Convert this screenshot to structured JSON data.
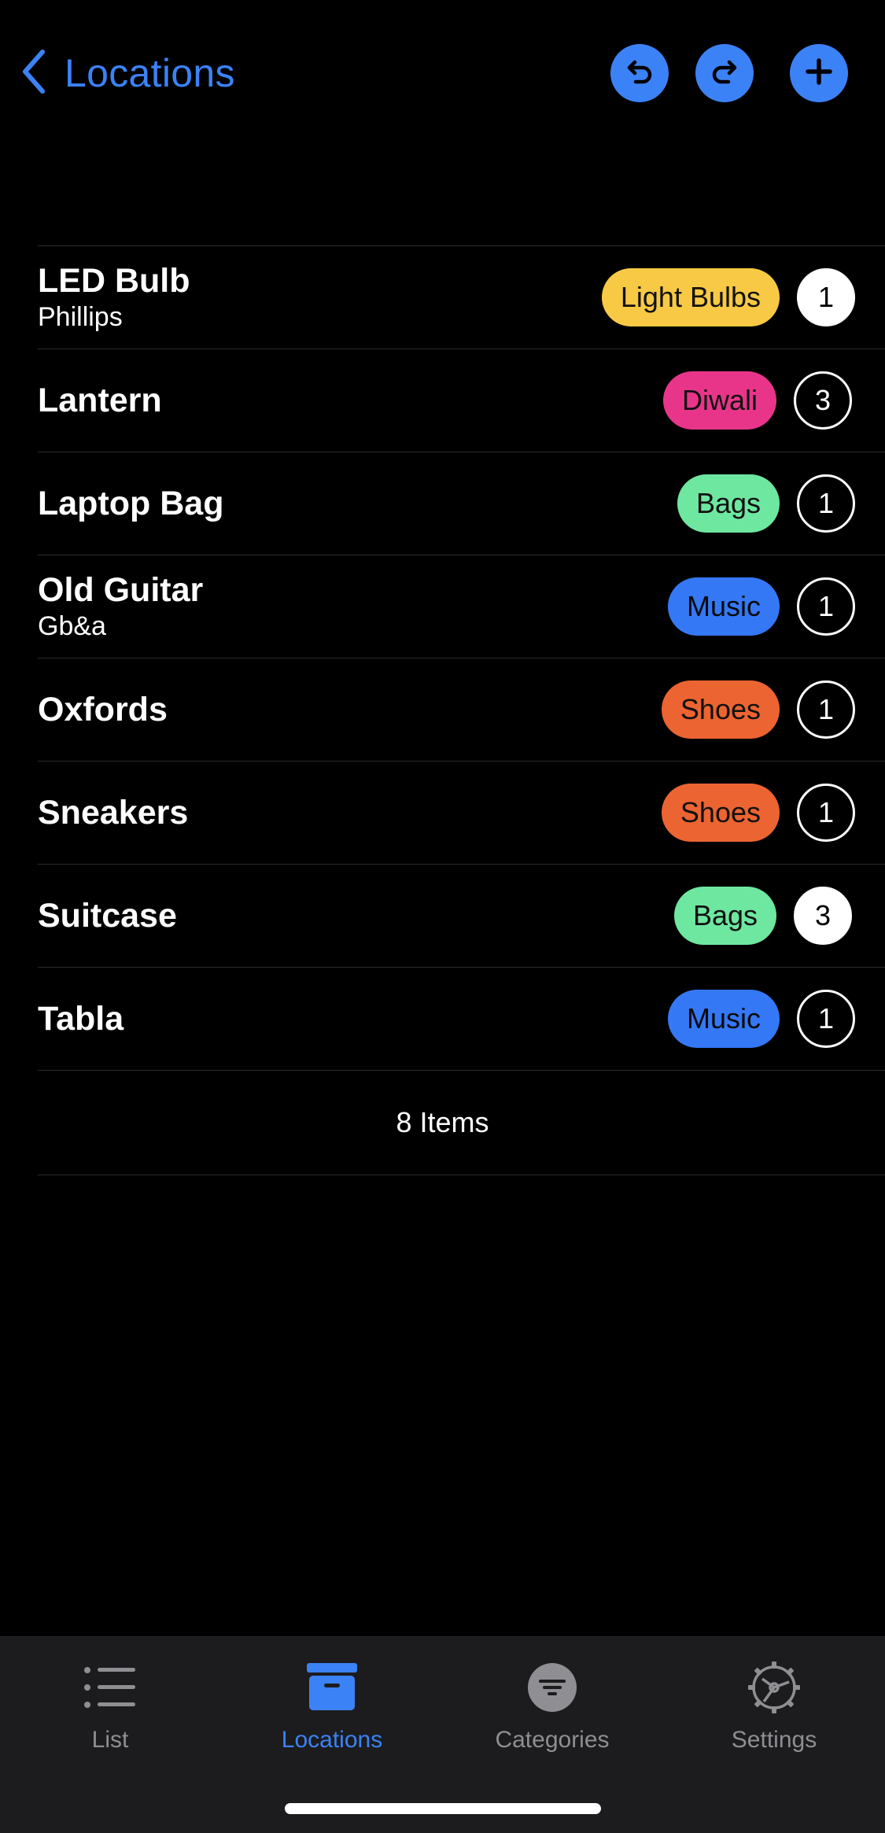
{
  "header": {
    "back_label": "Locations"
  },
  "items": [
    {
      "name": "LED Bulb",
      "subtitle": "Phillips",
      "category": "Light Bulbs",
      "category_color": "#f8c944",
      "count": "1",
      "count_filled": true
    },
    {
      "name": "Lantern",
      "subtitle": "",
      "category": "Diwali",
      "category_color": "#e8358a",
      "count": "3",
      "count_filled": false
    },
    {
      "name": "Laptop Bag",
      "subtitle": "",
      "category": "Bags",
      "category_color": "#6ee7a0",
      "count": "1",
      "count_filled": false
    },
    {
      "name": "Old Guitar",
      "subtitle": "Gb&a",
      "category": "Music",
      "category_color": "#3478f6",
      "count": "1",
      "count_filled": false
    },
    {
      "name": "Oxfords",
      "subtitle": "",
      "category": "Shoes",
      "category_color": "#ec6431",
      "count": "1",
      "count_filled": false
    },
    {
      "name": "Sneakers",
      "subtitle": "",
      "category": "Shoes",
      "category_color": "#ec6431",
      "count": "1",
      "count_filled": false
    },
    {
      "name": "Suitcase",
      "subtitle": "",
      "category": "Bags",
      "category_color": "#6ee7a0",
      "count": "3",
      "count_filled": true
    },
    {
      "name": "Tabla",
      "subtitle": "",
      "category": "Music",
      "category_color": "#3478f6",
      "count": "1",
      "count_filled": false
    }
  ],
  "footer": {
    "item_count": "8 Items"
  },
  "tabs": [
    {
      "label": "List",
      "icon": "list-icon",
      "active": false
    },
    {
      "label": "Locations",
      "icon": "archive-box-icon",
      "active": true
    },
    {
      "label": "Categories",
      "icon": "filter-icon",
      "active": false
    },
    {
      "label": "Settings",
      "icon": "gear-icon",
      "active": false
    }
  ],
  "colors": {
    "accent": "#3b82f6",
    "background": "#000000",
    "tabbar": "#1c1c1e",
    "inactive": "#8e8e93"
  }
}
